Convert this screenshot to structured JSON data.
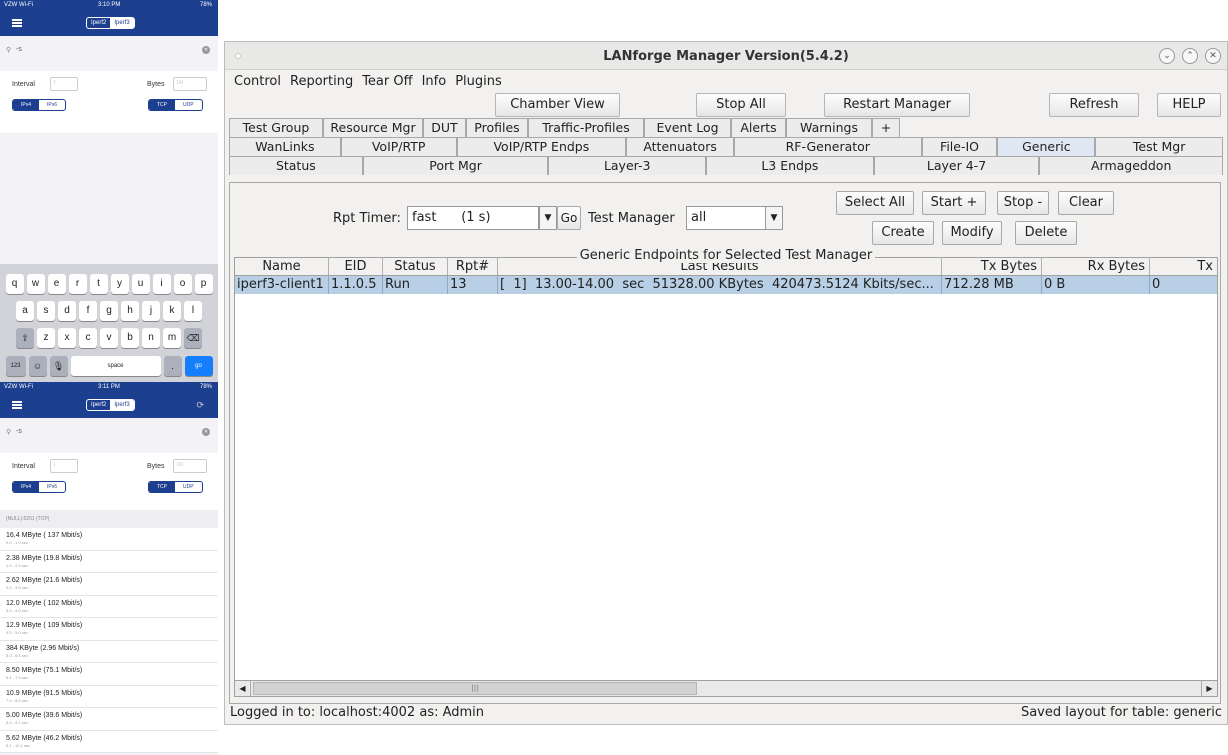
{
  "phone1": {
    "status": {
      "carrier": "VZW Wi-Fi",
      "time": "3:10 PM",
      "battery": "78%"
    },
    "nav": {
      "seg": [
        "Iperf2",
        "Iperf3"
      ]
    },
    "search": {
      "value": "-s",
      "clear_icon": "clear-icon"
    },
    "options": {
      "interval_label": "Interval",
      "interval_placeholder": "1",
      "bytes_label": "Bytes",
      "bytes_placeholder": "1M",
      "ip": [
        "IPv4",
        "IPv6"
      ],
      "proto": [
        "TCP",
        "UDP"
      ]
    },
    "keyboard": {
      "row1": [
        "q",
        "w",
        "e",
        "r",
        "t",
        "y",
        "u",
        "i",
        "o",
        "p"
      ],
      "row2": [
        "a",
        "s",
        "d",
        "f",
        "g",
        "h",
        "j",
        "k",
        "l"
      ],
      "row3": [
        "z",
        "x",
        "c",
        "v",
        "b",
        "n",
        "m"
      ],
      "space": "space",
      "go": "go",
      "num": "123",
      "dot": "."
    }
  },
  "phone2": {
    "status": {
      "carrier": "VZW Wi-Fi",
      "time": "3:11 PM",
      "battery": "78%"
    },
    "nav": {
      "seg": [
        "Iperf2",
        "Iperf3"
      ]
    },
    "search": {
      "value": "-s"
    },
    "options": {
      "interval_label": "Interval",
      "interval_placeholder": "1",
      "bytes_label": "Bytes",
      "bytes_placeholder": "1M",
      "ip": [
        "IPv4",
        "IPv6"
      ],
      "proto": [
        "TCP",
        "UDP"
      ]
    },
    "results_header": "(NULL):5201 (TCP)",
    "results": [
      {
        "main": "16.4 MByte ( 137 Mbit/s)",
        "sub": "0.0 - 1.0 sec"
      },
      {
        "main": "2.38 MByte (19.8 Mbit/s)",
        "sub": "1.0 - 2.0 sec"
      },
      {
        "main": "2.62 MByte (21.6 Mbit/s)",
        "sub": "2.0 - 3.0 sec"
      },
      {
        "main": "12.0 MByte ( 102 Mbit/s)",
        "sub": "3.0 - 4.0 sec"
      },
      {
        "main": "12.9 MByte ( 109 Mbit/s)",
        "sub": "4.0 - 5.0 sec"
      },
      {
        "main": "384 KByte (2.96 Mbit/s)",
        "sub": "5.0 - 6.1 sec"
      },
      {
        "main": "8.50 MByte (75.1 Mbit/s)",
        "sub": "6.1 - 7.0 sec"
      },
      {
        "main": "10.9 MByte (91.5 Mbit/s)",
        "sub": "7.0 - 8.0 sec"
      },
      {
        "main": "5.00 MByte (39.6 Mbit/s)",
        "sub": "8.0 - 9.1 sec"
      },
      {
        "main": "5.62 MByte (46.2 Mbit/s)",
        "sub": "9.1 - 10.1 sec"
      }
    ]
  },
  "window": {
    "title": "LANforge Manager   Version(5.4.2)",
    "menu": [
      "Control",
      "Reporting",
      "Tear Off",
      "Info",
      "Plugins"
    ],
    "toolbar": {
      "chamber": "Chamber View",
      "stopall": "Stop All",
      "restart": "Restart Manager",
      "refresh": "Refresh",
      "help": "HELP"
    },
    "tabs_row1": [
      "Test Group",
      "Resource Mgr",
      "DUT",
      "Profiles",
      "Traffic-Profiles",
      "Event Log",
      "Alerts",
      "Warnings",
      "+"
    ],
    "tabs_row2": [
      "WanLinks",
      "VoIP/RTP",
      "VoIP/RTP Endps",
      "Attenuators",
      "RF-Generator",
      "File-IO",
      "Generic",
      "Test Mgr"
    ],
    "tabs_row3": [
      "Status",
      "Port Mgr",
      "Layer-3",
      "L3 Endps",
      "Layer 4-7",
      "Armageddon"
    ],
    "selected_tab": "Generic",
    "controls": {
      "rpt_label": "Rpt Timer:",
      "rpt_value": "fast      (1 s)",
      "go": "Go",
      "tm_label": "Test Manager",
      "tm_value": "all",
      "select_all": "Select All",
      "start": "Start +",
      "stop": "Stop -",
      "clear": "Clear",
      "create": "Create",
      "modify": "Modify",
      "delete": "Delete"
    },
    "group_title": "Generic Endpoints for Selected Test Manager",
    "columns": [
      "Name",
      "EID",
      "Status",
      "Rpt#",
      "Last Results",
      "Tx Bytes",
      "Rx Bytes",
      "Tx"
    ],
    "rows": [
      [
        "iperf3-client1",
        "1.1.0.5",
        "Run",
        "13",
        "[  1]  13.00-14.00  sec  51328.00 KBytes  420473.5124 Kbits/sec...",
        "712.28 MB",
        "0 B",
        "0"
      ]
    ],
    "status_left": "Logged in to:  localhost:4002  as:  Admin",
    "status_right": "Saved layout for table: generic"
  }
}
